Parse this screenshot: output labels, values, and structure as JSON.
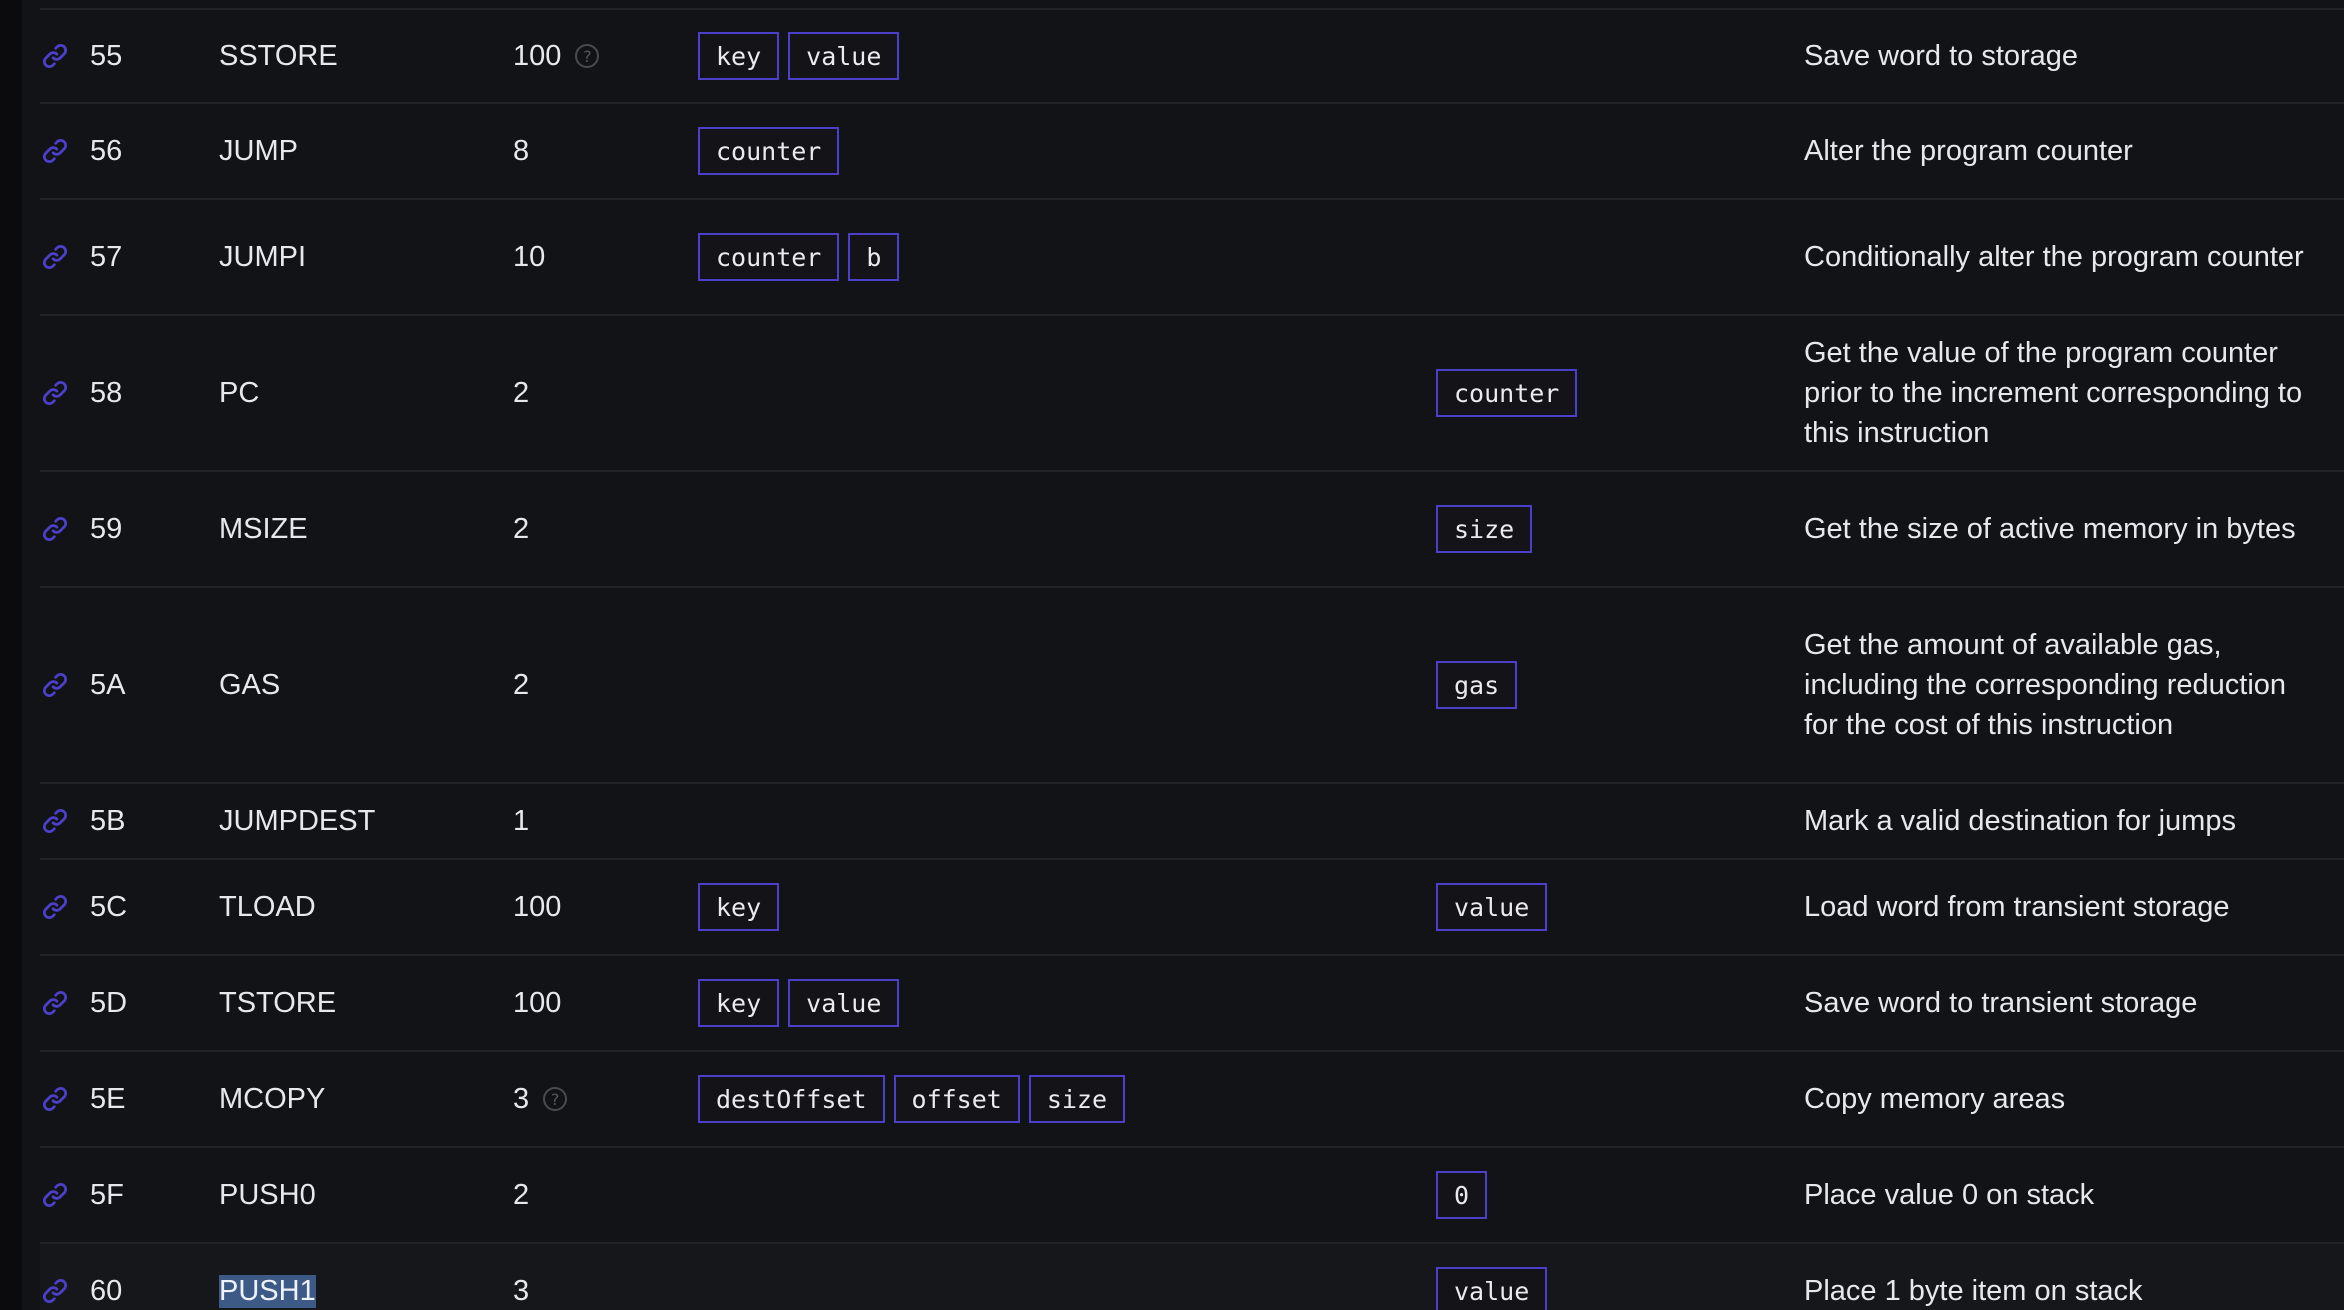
{
  "accent_color": "#4c3fc9",
  "rows": [
    {
      "code": "55",
      "name": "SSTORE",
      "gas": "100",
      "gas_help": true,
      "inputs": [
        "key",
        "value"
      ],
      "outputs": [],
      "desc": "Save word to storage"
    },
    {
      "code": "56",
      "name": "JUMP",
      "gas": "8",
      "gas_help": false,
      "inputs": [
        "counter"
      ],
      "outputs": [],
      "desc": "Alter the program counter"
    },
    {
      "code": "57",
      "name": "JUMPI",
      "gas": "10",
      "gas_help": false,
      "inputs": [
        "counter",
        "b"
      ],
      "outputs": [],
      "desc": "Conditionally alter the program counter"
    },
    {
      "code": "58",
      "name": "PC",
      "gas": "2",
      "gas_help": false,
      "inputs": [],
      "outputs": [
        "counter"
      ],
      "desc": "Get the value of the program counter prior to the increment corresponding to this instruction"
    },
    {
      "code": "59",
      "name": "MSIZE",
      "gas": "2",
      "gas_help": false,
      "inputs": [],
      "outputs": [
        "size"
      ],
      "desc": "Get the size of active memory in bytes"
    },
    {
      "code": "5A",
      "name": "GAS",
      "gas": "2",
      "gas_help": false,
      "inputs": [],
      "outputs": [
        "gas"
      ],
      "desc": "Get the amount of available gas, including the corresponding reduction for the cost of this instruction"
    },
    {
      "code": "5B",
      "name": "JUMPDEST",
      "gas": "1",
      "gas_help": false,
      "inputs": [],
      "outputs": [],
      "desc": "Mark a valid destination for jumps"
    },
    {
      "code": "5C",
      "name": "TLOAD",
      "gas": "100",
      "gas_help": false,
      "inputs": [
        "key"
      ],
      "outputs": [
        "value"
      ],
      "desc": "Load word from transient storage"
    },
    {
      "code": "5D",
      "name": "TSTORE",
      "gas": "100",
      "gas_help": false,
      "inputs": [
        "key",
        "value"
      ],
      "outputs": [],
      "desc": "Save word to transient storage"
    },
    {
      "code": "5E",
      "name": "MCOPY",
      "gas": "3",
      "gas_help": true,
      "inputs": [
        "destOffset",
        "offset",
        "size"
      ],
      "outputs": [],
      "desc": "Copy memory areas"
    },
    {
      "code": "5F",
      "name": "PUSH0",
      "gas": "2",
      "gas_help": false,
      "inputs": [],
      "outputs": [
        "0"
      ],
      "desc": "Place value 0 on stack"
    },
    {
      "code": "60",
      "name": "PUSH1",
      "gas": "3",
      "gas_help": false,
      "inputs": [],
      "outputs": [
        "value"
      ],
      "desc": "Place 1 byte item on stack",
      "name_selected": true
    }
  ]
}
